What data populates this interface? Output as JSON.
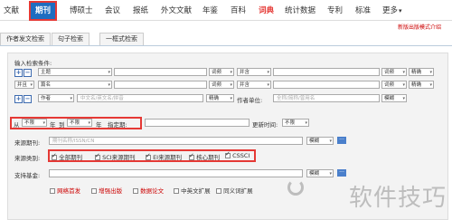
{
  "nav": {
    "items": [
      {
        "label": "文献"
      },
      {
        "label": "期刊"
      },
      {
        "label": "博硕士"
      },
      {
        "label": "会议"
      },
      {
        "label": "报纸"
      },
      {
        "label": "外文文献"
      },
      {
        "label": "年鉴"
      },
      {
        "label": "百科"
      },
      {
        "label": "词典"
      },
      {
        "label": "统计数据"
      },
      {
        "label": "专利"
      },
      {
        "label": "标准"
      },
      {
        "label": "更多"
      }
    ],
    "active": "期刊",
    "highlight_color": "#e53935",
    "active_bg": "#1e6dc0"
  },
  "subline": {
    "link": "新版出版模式介绍"
  },
  "tabs": [
    "作者发文检索",
    "句子检索",
    "一框式检索"
  ],
  "panel": {
    "title": "输入检索条件:",
    "rows": [
      {
        "logic": "",
        "field": "主题",
        "freq": "词频",
        "op": "并含",
        "freq2": "词频",
        "match": "精确"
      },
      {
        "logic": "并且",
        "field": "篇名",
        "freq": "词频",
        "op": "并含",
        "freq2": "词频",
        "match": "精确"
      }
    ],
    "author": {
      "field": "作者",
      "placeholder": "中文名/英文名/拼音",
      "match": "精确",
      "unit_label": "作者单位:",
      "unit_placeholder": "全称/简称/曾用名",
      "unit_match": "模糊"
    },
    "date": {
      "from_label": "从",
      "from_value": "不限",
      "year1": "年",
      "to_label": "到",
      "to_value": "不限",
      "year2": "年",
      "specific_label": "指定期:",
      "update_label": "更新时间:",
      "update_value": "不限"
    },
    "journal": {
      "label": "来源期刊:",
      "placeholder": "期刊名称/ISSN/CN",
      "match": "模糊",
      "dots": "···"
    },
    "category": {
      "label": "来源类别:",
      "options": [
        {
          "label": "全部期刊",
          "checked": true
        },
        {
          "label": "SCI来源期刊",
          "checked": true
        },
        {
          "label": "EI来源期刊",
          "checked": true
        },
        {
          "label": "核心期刊",
          "checked": true
        },
        {
          "label": "CSSCI",
          "checked": true
        }
      ]
    },
    "fund": {
      "label": "支持基金:",
      "match": "模糊",
      "dots": "···"
    },
    "extras": [
      {
        "label": "网络首发",
        "checked": false,
        "red": true
      },
      {
        "label": "增强出版",
        "checked": false,
        "red": true
      },
      {
        "label": "数据论文",
        "checked": false,
        "red": true
      },
      {
        "label": "中英文扩展",
        "checked": false,
        "red": false
      },
      {
        "label": "同义词扩展",
        "checked": false,
        "red": false
      }
    ]
  },
  "watermark": "软件技巧"
}
